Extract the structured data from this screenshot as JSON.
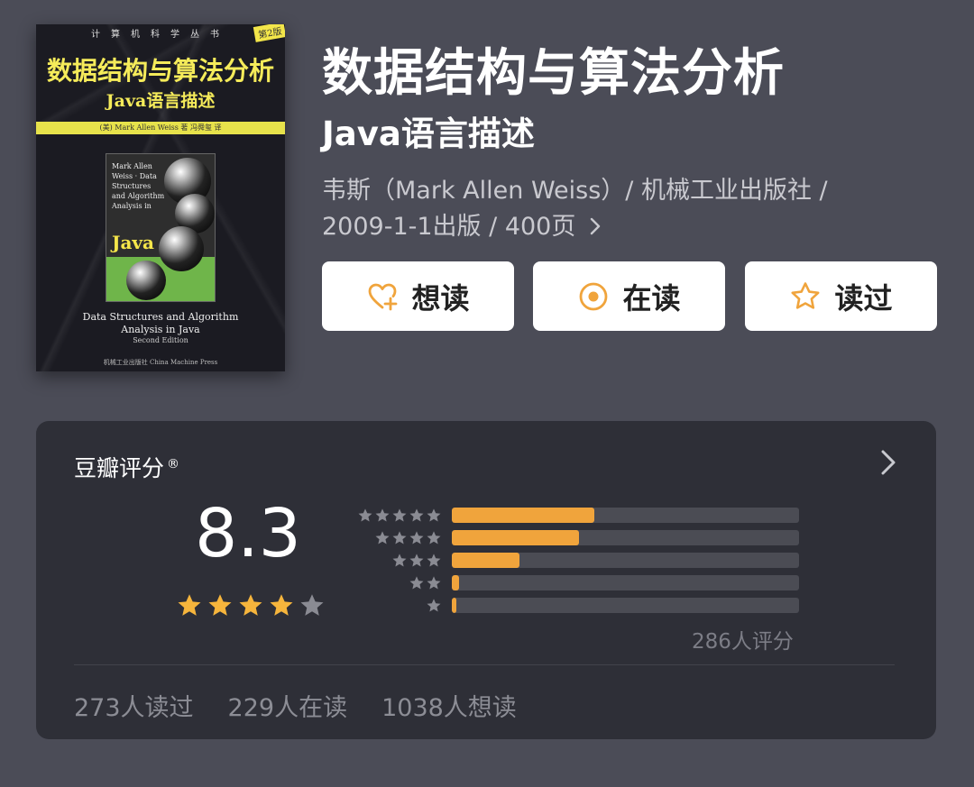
{
  "cover": {
    "series": "计算机科学丛书",
    "edition": "第2版",
    "title": "数据结构与算法分析",
    "subtitle": "Java语言描述",
    "band": "(美) Mark Allen Weiss 著  冯舜玺 译",
    "inset_text": "Mark Allen Weiss · Data Structures and Algorithm Analysis in",
    "inset_java": "Java",
    "english_title": "Data Structures and Algorithm Analysis in Java",
    "english_edition": "Second Edition",
    "publisher": "机械工业出版社 China Machine Press"
  },
  "book": {
    "title": "数据结构与算法分析",
    "subtitle": "Java语言描述",
    "meta_line1": "韦斯（Mark Allen Weiss）/ 机械工业出版社 /",
    "meta_line2": "2009-1-1出版 / 400页"
  },
  "actions": {
    "want_label": "想读",
    "reading_label": "在读",
    "read_label": "读过"
  },
  "rating": {
    "section_title": "豆瓣评分",
    "registered_mark": "®",
    "score": "8.3",
    "stars_filled": 4,
    "stars_total": 5,
    "distribution": [
      {
        "stars": 5,
        "fraction": 0.41
      },
      {
        "stars": 4,
        "fraction": 0.365
      },
      {
        "stars": 3,
        "fraction": 0.195
      },
      {
        "stars": 2,
        "fraction": 0.02
      },
      {
        "stars": 1,
        "fraction": 0.012
      }
    ],
    "count_label": "286人评分"
  },
  "stats": {
    "read": "273人读过",
    "reading": "229人在读",
    "want": "1038人想读"
  },
  "colors": {
    "background": "#4b4c57",
    "card": "#2e2f37",
    "accent": "#f0a43c",
    "star_gold": "#f6b53c",
    "star_gray": "#8a8b93"
  }
}
